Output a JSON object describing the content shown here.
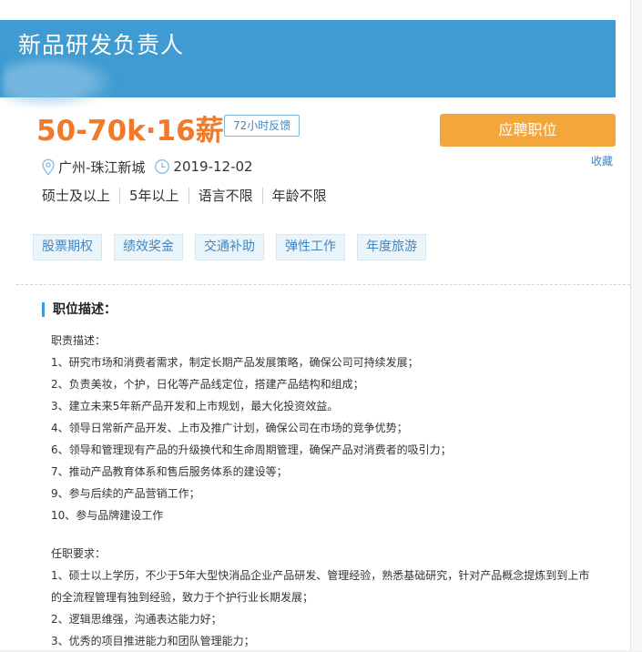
{
  "job": {
    "title": "新品研发负责人",
    "salary": "50-70k·16薪",
    "feedback_badge": "72小时反馈",
    "apply_label": "应聘职位",
    "favorite_label": "收藏",
    "location": "广州-珠江新城",
    "date": "2019-12-02",
    "requirements": [
      "硕士及以上",
      "5年以上",
      "语言不限",
      "年龄不限"
    ],
    "benefits": [
      "股票期权",
      "绩效奖金",
      "交通补助",
      "弹性工作",
      "年度旅游"
    ]
  },
  "description": {
    "section_title": "职位描述：",
    "duties_heading": "职责描述：",
    "duties": [
      "1、研究市场和消费者需求，制定长期产品发展策略，确保公司可持续发展；",
      "2、负责美妆，个护，日化等产品线定位，搭建产品结构和组成；",
      "3、建立未来5年新产品开发和上市规划，最大化投资效益。",
      "4、领导日常新产品开发、上市及推广计划，确保公司在市场的竞争优势；",
      "6、领导和管理现有产品的升级换代和生命周期管理，确保产品对消费者的吸引力；",
      "7、推动产品教育体系和售后服务体系的建设等；",
      "9、参与后续的产品营销工作；",
      "10、参与品牌建设工作"
    ],
    "requirements_heading": "任职要求：",
    "requirements": [
      "1、硕士以上学历，不少于5年大型快消品企业产品研发、管理经验，熟悉基础研究，针对产品概念提炼到到上市",
      "的全流程管理有独到经验，致力于个护行业长期发展；",
      "2、逻辑思维强，沟通表达能力好；",
      "3、优秀的项目推进能力和团队管理能力；"
    ]
  },
  "colors": {
    "header": "#3f9bd1",
    "salary": "#f07a2a",
    "apply_button": "#f4a63b",
    "link": "#3f86c2"
  },
  "icons": [
    "location-pin-icon",
    "clock-icon"
  ]
}
